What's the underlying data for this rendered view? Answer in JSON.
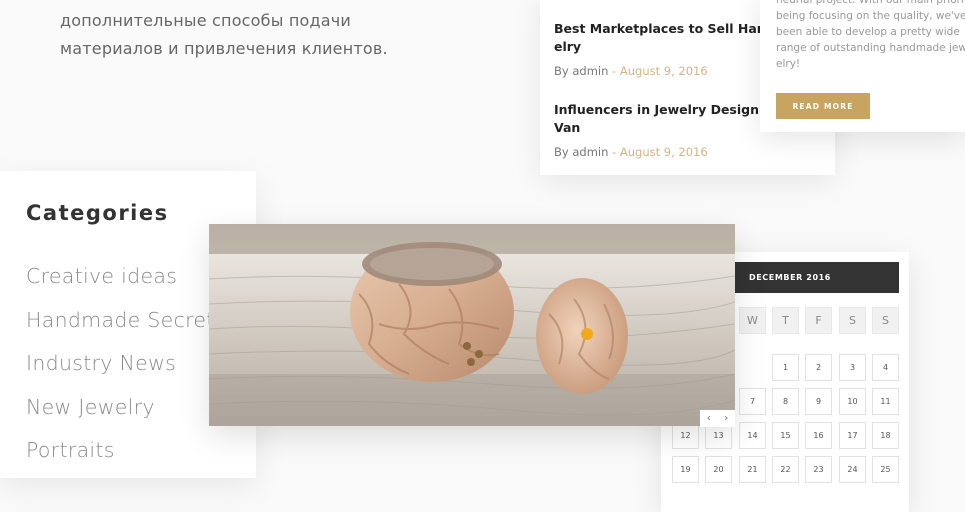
{
  "intro": {
    "lines": [
      "дополнительные способы подачи",
      "материалов и привлечения клиентов."
    ]
  },
  "recent_posts": [
    {
      "title": "Best Marketplaces to Sell Handmade Jewelry",
      "title_lines": "Best Marketplaces to Sell Handmad\nelry",
      "by": "By admin",
      "sep": " - ",
      "date": "August 9, 2016"
    },
    {
      "title": "Influencers in Jewelry Design: Martin Van",
      "title_lines": "Influencers in Jewelry Design: Mart\nVan",
      "by": "By admin",
      "sep": " - ",
      "date": "August 9, 2016"
    }
  ],
  "about": {
    "lines": [
      "neurial project. With our main priority",
      "being focusing on the quality, we've",
      "been able to develop a pretty wide",
      "range of outstanding handmade jew-",
      "elry!"
    ],
    "button": "READ MORE"
  },
  "categories": {
    "title": "Categories",
    "items": [
      "Creative ideas",
      "Handmade Secrets",
      "Industry News",
      "New Jewelry",
      "Portraits"
    ]
  },
  "calendar": {
    "month": "DECEMBER 2016",
    "weekdays": [
      "W",
      "T",
      "F",
      "S",
      "S"
    ],
    "days": [
      "1",
      "2",
      "3",
      "4",
      "7",
      "8",
      "9",
      "10",
      "11",
      "12",
      "13",
      "14",
      "15",
      "16",
      "17",
      "18",
      "19",
      "20",
      "21",
      "22",
      "23",
      "24",
      "25"
    ]
  },
  "slider": {
    "prev": "‹",
    "next": "›"
  },
  "colors": {
    "accent": "#c7a45f",
    "date": "#d4b483",
    "dark": "#333333"
  }
}
